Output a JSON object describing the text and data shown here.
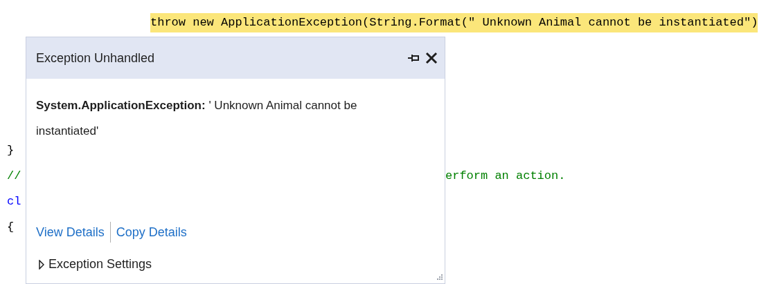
{
  "code_lines": [
    {
      "text": "throw new ApplicationException(String.Format(\" Unknown Animal cannot be instantiated\")",
      "kind": "plain",
      "highlighted": true
    },
    {
      "text": "}",
      "kind": "plain",
      "highlighted": false
    },
    {
      "text": "//",
      "kind": "comment",
      "highlighted": false,
      "continuation": "erform an action."
    },
    {
      "text": "cl",
      "kind": "keyword",
      "highlighted": false
    },
    {
      "text": "{",
      "kind": "plain",
      "highlighted": false
    }
  ],
  "exception_popup": {
    "title": "Exception Unhandled",
    "message": "**System.ApplicationException:** ' Unknown Animal cannot be instantiated'",
    "links": [
      "View Details",
      "Copy Details"
    ],
    "settings": {
      "label": "Exception Settings",
      "expanded": false
    }
  }
}
